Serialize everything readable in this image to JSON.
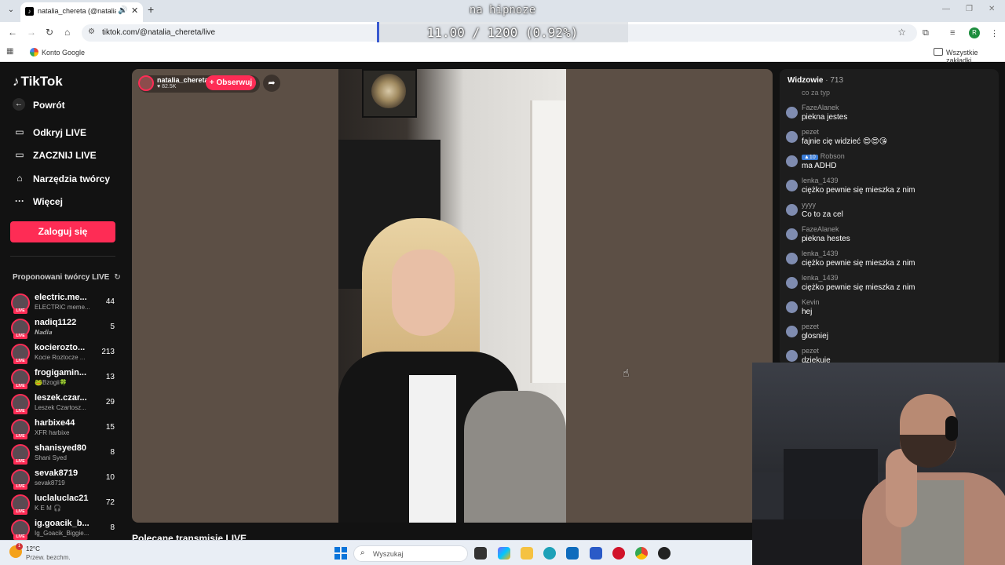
{
  "browser": {
    "tab_title": "natalia_chereta (@natalia_c...",
    "url": "tiktok.com/@natalia_chereta/live",
    "profile_initial": "R",
    "bookmark_google": "Konto Google",
    "bookmark_all": "Wszystkie zakładki"
  },
  "overlay": {
    "title": "na hipnoze",
    "progress_text": "11.00 / 1200 (0.92%)",
    "progress_fraction": 0.0092
  },
  "sidebar": {
    "logo": "TikTok",
    "back": "Powrót",
    "nav": [
      "Odkryj LIVE",
      "ZACZNIJ LIVE",
      "Narzędzia twórcy",
      "Więcej"
    ],
    "login": "Zaloguj się",
    "suggest_title": "Proponowani twórcy LIVE",
    "creators": [
      {
        "name": "electric.me...",
        "sub": "ELECTRIC meme...",
        "count": "44"
      },
      {
        "name": "nadiq1122",
        "sub": "𝑵𝒂𝒅𝒊𝒂",
        "count": "5"
      },
      {
        "name": "kocierozto...",
        "sub": "Kocie Roztocze ...",
        "count": "213"
      },
      {
        "name": "frogigamin...",
        "sub": "🐸Bzogii🍀",
        "count": "13"
      },
      {
        "name": "leszek.czar...",
        "sub": "Leszek Czartosz...",
        "count": "29"
      },
      {
        "name": "harbixe44",
        "sub": "XFR harbixe",
        "count": "15"
      },
      {
        "name": "shanisyed80",
        "sub": "Shani Syed",
        "count": "8"
      },
      {
        "name": "sevak8719",
        "sub": "sevak8719",
        "count": "10"
      },
      {
        "name": "luclaluclac21",
        "sub": "K E M 🎧",
        "count": "72"
      },
      {
        "name": "ig.goacik_b...",
        "sub": "Ig_Goacik_Biggie...",
        "count": "8"
      }
    ]
  },
  "stream": {
    "streamer_name": "natalia_chereta",
    "likes": "♥ 82.5K",
    "follow": "+ Obserwuj",
    "section_title": "Polecane transmisje LIVE"
  },
  "chat": {
    "header_label": "Widzowie",
    "viewer_count": "· 713",
    "cut_message": "co za typ",
    "messages": [
      {
        "user": "FazeAlanek",
        "badge": "",
        "text": "piekna jestes"
      },
      {
        "user": "pezet",
        "badge": "",
        "text": "fajnie cię widzieć 😍😍😘"
      },
      {
        "user": "Robson",
        "badge": "▲10",
        "text": "ma ADHD"
      },
      {
        "user": "lenka_1439",
        "badge": "",
        "text": "ciężko pewnie się mieszka z nim"
      },
      {
        "user": "yyyy",
        "badge": "",
        "text": "Co to za cel"
      },
      {
        "user": "FazeAlanek",
        "badge": "",
        "text": "piekna hestes"
      },
      {
        "user": "lenka_1439",
        "badge": "",
        "text": "ciężko pewnie się mieszka z nim"
      },
      {
        "user": "lenka_1439",
        "badge": "",
        "text": "ciężko pewnie się mieszka z nim"
      },
      {
        "user": "Kevin",
        "badge": "",
        "text": "hej"
      },
      {
        "user": "pezet",
        "badge": "",
        "text": "glosniej"
      },
      {
        "user": "pezet",
        "badge": "",
        "text": "dziekuje"
      }
    ]
  },
  "taskbar": {
    "weather_badge": "1",
    "temperature": "12°C",
    "weather_desc": "Przew. bezchm.",
    "search_placeholder": "Wyszukaj"
  },
  "colors": {
    "accent": "#fe2c55",
    "page_bg": "#121212",
    "video_bg": "#5c4f45",
    "chat_bg": "#1d1d1d",
    "progress_fill": "#3a5ad0"
  }
}
